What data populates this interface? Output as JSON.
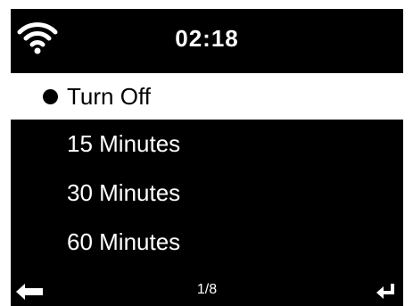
{
  "status_bar": {
    "time": "02:18",
    "wifi_icon": "wifi-icon"
  },
  "menu": {
    "items": [
      {
        "label": "Turn Off",
        "selected": true
      },
      {
        "label": "15 Minutes",
        "selected": false
      },
      {
        "label": "30 Minutes",
        "selected": false
      },
      {
        "label": "60 Minutes",
        "selected": false
      }
    ]
  },
  "footer": {
    "page": "1/8",
    "back_icon": "back-arrow-icon",
    "enter_icon": "enter-icon"
  },
  "colors": {
    "background": "#000000",
    "foreground": "#ffffff",
    "highlight_bg": "#ffffff",
    "highlight_fg": "#000000"
  }
}
